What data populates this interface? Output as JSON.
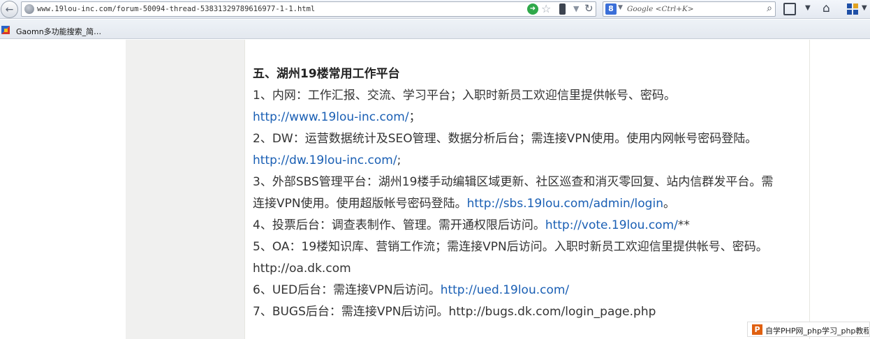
{
  "browser": {
    "back_glyph": "←",
    "url": "www.19lou-inc.com/forum-50094-thread-53831329789616977-1-1.html",
    "search_placeholder": "Google <Ctrl+K>",
    "search_engine_letter": "8",
    "bookmarks": [
      {
        "label": "Gaomn多功能搜索_简…"
      }
    ]
  },
  "article": {
    "heading": "五、湖州19楼常用工作平台",
    "lines": [
      {
        "text": "1、内网：工作汇报、交流、学习平台；入职时新员工欢迎信里提供帐号、密码。",
        "link": "",
        "suffix": ""
      },
      {
        "text": "",
        "link": "http://www.19lou-inc.com/",
        "suffix": "；"
      },
      {
        "text": "2、DW：运营数据统计及SEO管理、数据分析后台；需连接VPN使用。使用内网帐号密码登陆。",
        "link": "",
        "suffix": ""
      },
      {
        "text": "",
        "link": "http://dw.19lou-inc.com/",
        "suffix": ";"
      },
      {
        "text": "3、外部SBS管理平台：湖州19楼手动编辑区域更新、社区巡查和消灭零回复、站内信群发平台。需",
        "link": "",
        "suffix": ""
      },
      {
        "text": "连接VPN使用。使用超版帐号密码登陆。",
        "link": "http://sbs.19lou.com/admin/login",
        "suffix": "。"
      },
      {
        "text": "4、投票后台：调查表制作、管理。需开通权限后访问。",
        "link": "http://vote.19lou.com/",
        "suffix": "**"
      },
      {
        "text": "5、OA：19楼知识库、营销工作流；需连接VPN后访问。入职时新员工欢迎信里提供帐号、密码。",
        "link": "",
        "suffix": ""
      },
      {
        "text": "http://oa.dk.com",
        "link": "",
        "suffix": ""
      },
      {
        "text": "6、UED后台：需连接VPN后访问。",
        "link": "http://ued.19lou.com/",
        "suffix": ""
      },
      {
        "text": "7、BUGS后台：需连接VPN后访问。http://bugs.dk.com/login_page.php",
        "link": "",
        "suffix": ""
      }
    ]
  },
  "watermark": {
    "logo_letter": "P",
    "text": "自学PHP网_php学习_php教程"
  },
  "colors": {
    "link": "#1a5fb4",
    "text": "#333333",
    "side_gray": "#f0f0ef"
  }
}
